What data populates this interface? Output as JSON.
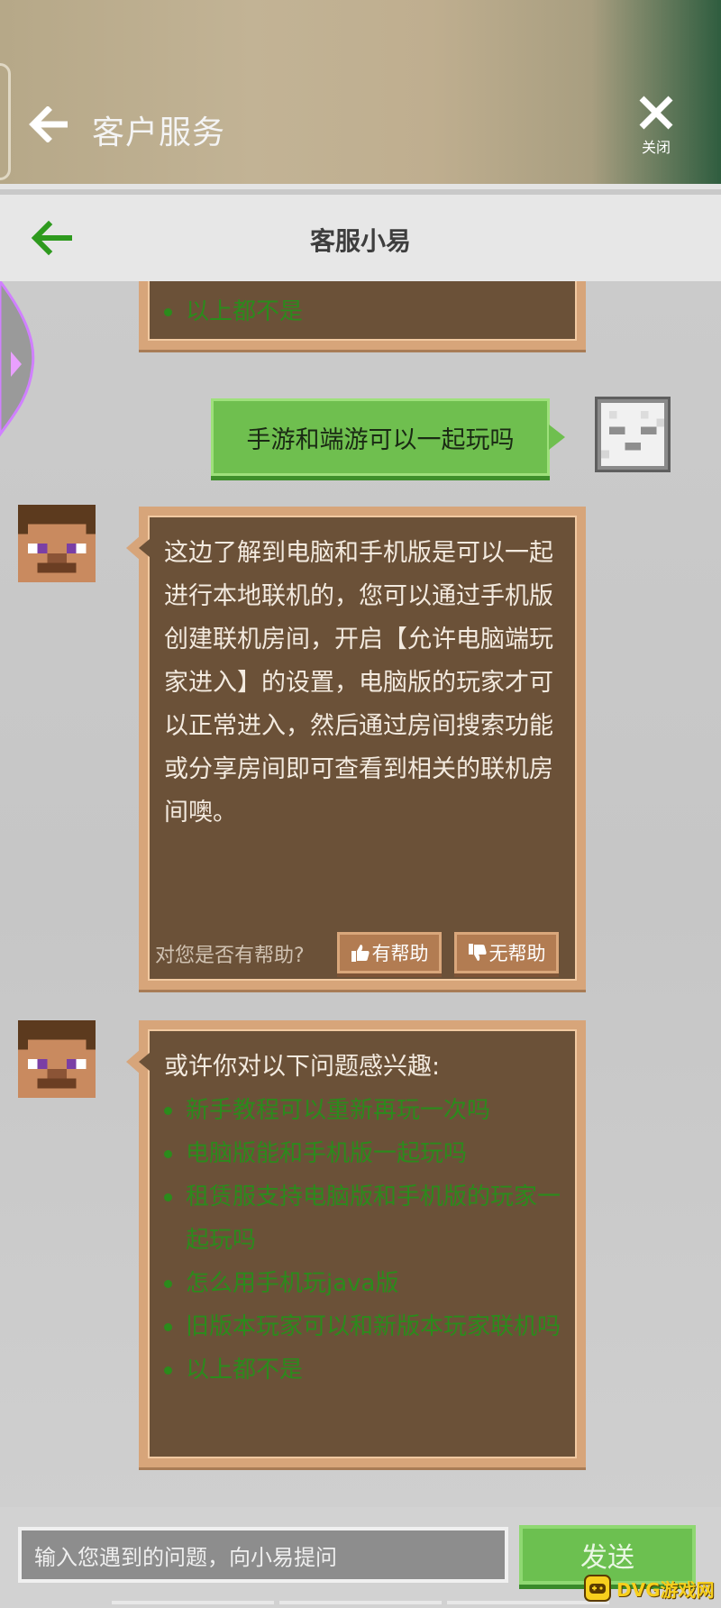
{
  "outer_header": {
    "title": "客户服务",
    "close_label": "关闭"
  },
  "inner_header": {
    "title": "客服小易"
  },
  "messages": {
    "previous_tail_link": "以上都不是",
    "user_message": "手游和端游可以一起玩吗",
    "answer_text": "这边了解到电脑和手机版是可以一起进行本地联机的，您可以通过手机版创建联机房间，开启【允许电脑端玩家进入】的设置，电脑版的玩家才可以正常进入，然后通过房间搜索功能或分享房间即可查看到相关的联机房间噢。",
    "helpful_question": "对您是否有帮助?",
    "helpful_yes": "有帮助",
    "helpful_no": "无帮助",
    "suggest_title": "或许你对以下问题感兴趣:",
    "suggestions": [
      "新手教程可以重新再玩一次吗",
      "电脑版能和手机版一起玩吗",
      "租赁服支持电脑版和手机版的玩家一起玩吗",
      "怎么用手机玩java版",
      "旧版本玩家可以和新版本玩家联机吗",
      "以上都不是"
    ]
  },
  "input": {
    "placeholder": "输入您遇到的问题，向小易提问",
    "send_label": "发送"
  },
  "watermark": {
    "text": "DVG游戏网"
  },
  "colors": {
    "bubble_bg": "#6b5138",
    "bubble_border": "#d7a57a",
    "link_green": "#2b8b1c",
    "user_bubble": "#6fbf4f",
    "send_button": "#6cc050",
    "accent_back_arrow": "#2e9a1e"
  }
}
